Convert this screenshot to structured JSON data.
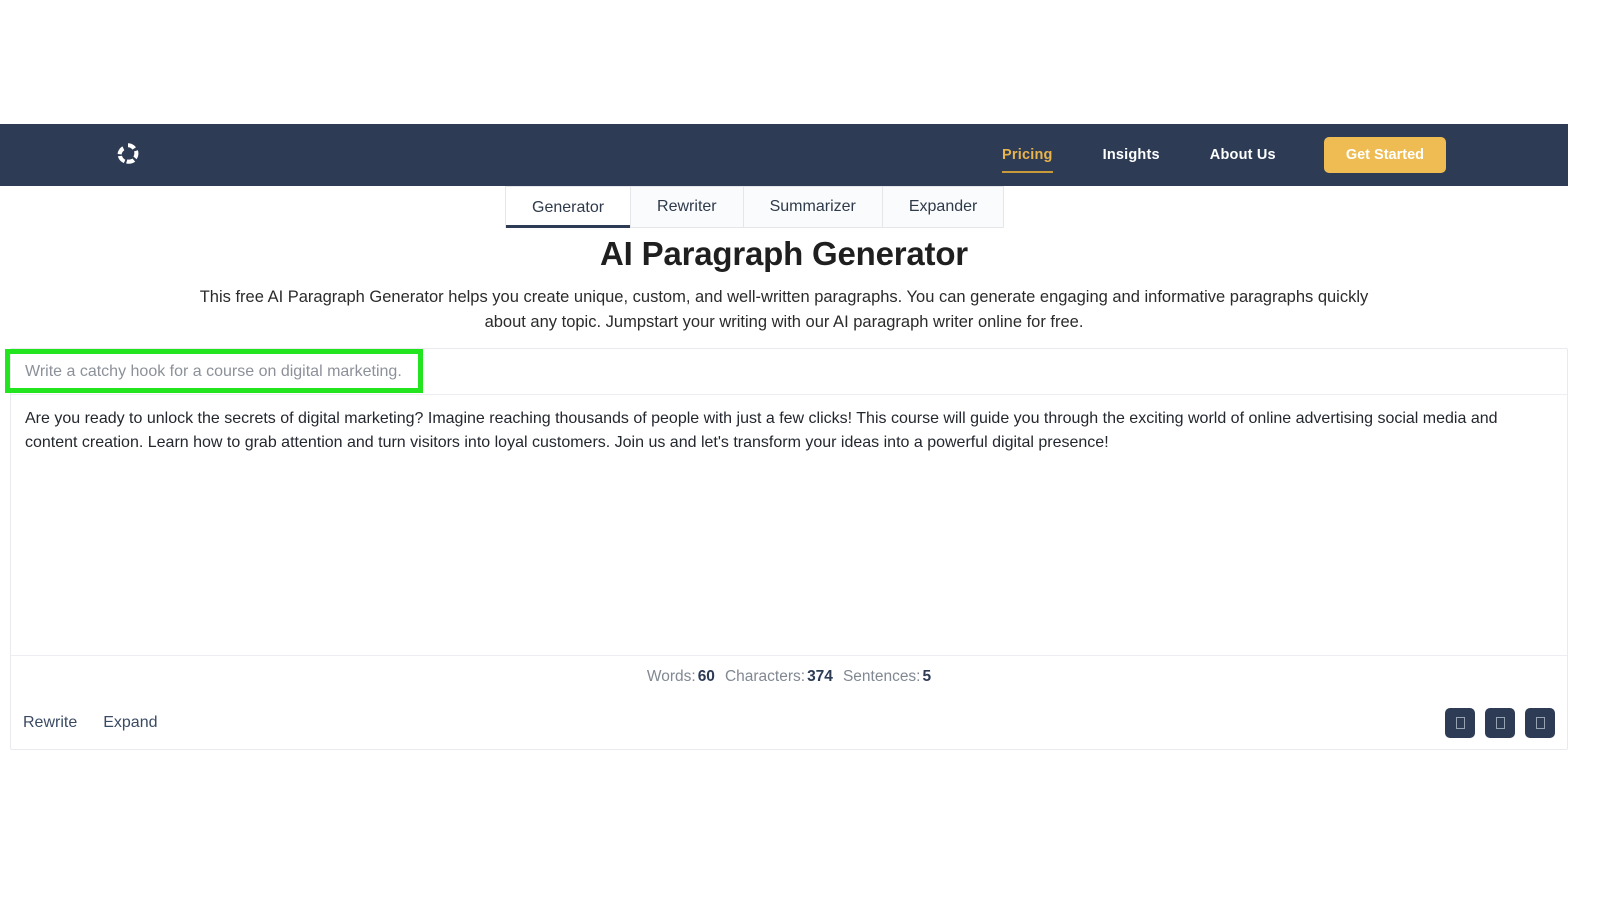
{
  "navbar": {
    "logo_icon": "pinwheel-logo-icon",
    "background_color": "#2d3b55",
    "accent_color": "#e9b44c",
    "links": [
      {
        "label": "Pricing",
        "active": true
      },
      {
        "label": "Insights",
        "active": false
      },
      {
        "label": "About Us",
        "active": false
      }
    ],
    "cta_label": "Get Started",
    "cta_color": "#eebc52"
  },
  "tabs": [
    {
      "label": "Generator",
      "active": true
    },
    {
      "label": "Rewriter",
      "active": false
    },
    {
      "label": "Summarizer",
      "active": false
    },
    {
      "label": "Expander",
      "active": false
    }
  ],
  "header": {
    "title": "AI Paragraph Generator",
    "description": "This free AI Paragraph Generator helps you create unique, custom, and well-written paragraphs. You can generate engaging and informative paragraphs quickly about any topic. Jumpstart your writing with our AI paragraph writer online for free."
  },
  "editor": {
    "prompt_placeholder": "Write a catchy hook for a course on digital marketing.",
    "prompt_value": "",
    "output_text": "Are you ready to unlock the secrets of digital marketing? Imagine reaching thousands of people with just a few clicks! This course will guide you through the exciting world of online advertising social media and content creation. Learn how to grab attention and turn visitors into loyal customers. Join us and let's transform your ideas into a powerful digital presence!"
  },
  "stats": {
    "words_label": "Words:",
    "words_value": "60",
    "characters_label": "Characters:",
    "characters_value": "374",
    "sentences_label": "Sentences:",
    "sentences_value": "5"
  },
  "actions": {
    "rewrite_label": "Rewrite",
    "expand_label": "Expand",
    "icon_buttons": [
      {
        "name": "copy-icon"
      },
      {
        "name": "download-icon"
      },
      {
        "name": "share-icon"
      }
    ]
  },
  "annotation": {
    "color": "#22e520",
    "target": "prompt-input"
  }
}
